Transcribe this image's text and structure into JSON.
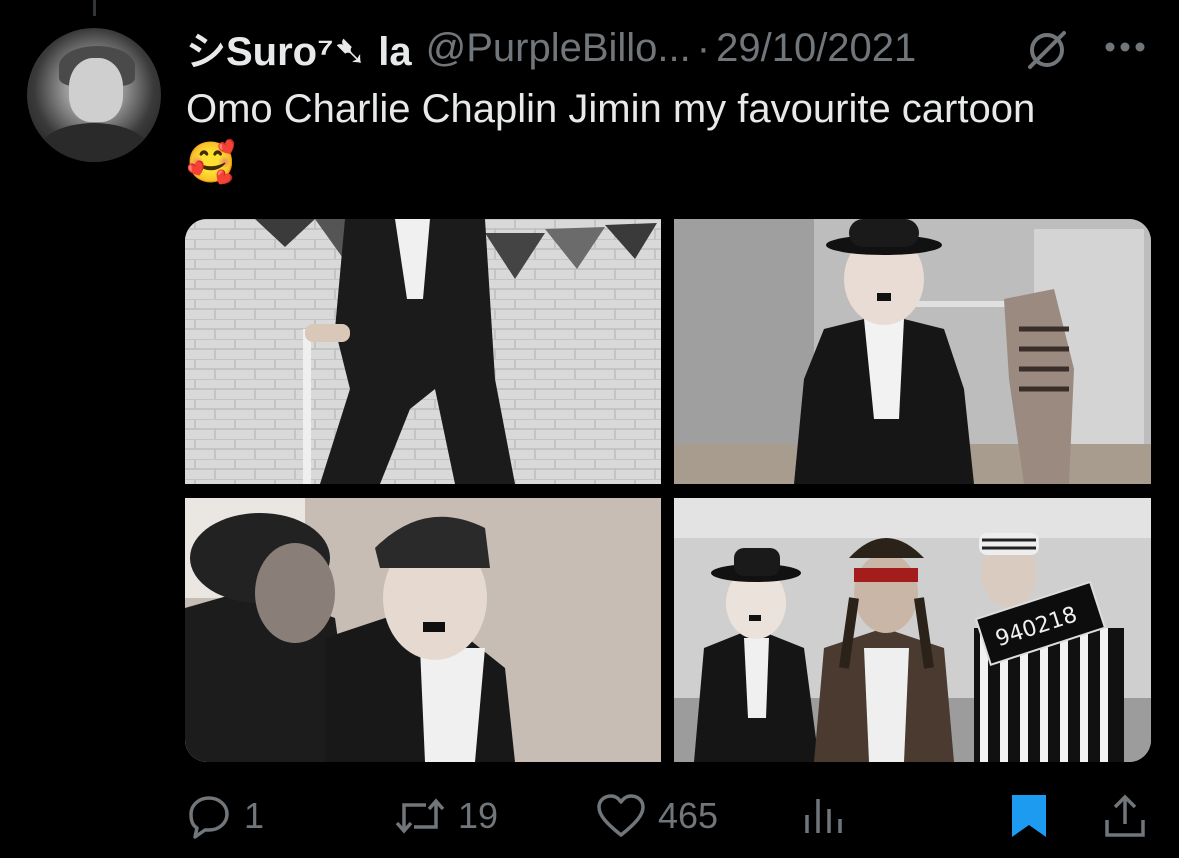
{
  "tweet": {
    "display_name": "シSuro⁷➷ la",
    "handle": "@PurpleBillo...",
    "separator": "·",
    "date": "29/10/2021",
    "text": "Omo Charlie Chaplin Jimin my favourite cartoon 🥰"
  },
  "actions": {
    "replies": "1",
    "retweets": "19",
    "likes": "465"
  },
  "colors": {
    "background": "#000000",
    "text": "#e7e9ea",
    "muted": "#71767b",
    "bookmark_active": "#1d9bf0"
  },
  "icons": [
    "grok-icon",
    "more-icon",
    "reply-icon",
    "retweet-icon",
    "like-icon",
    "analytics-icon",
    "bookmark-icon",
    "share-icon"
  ]
}
